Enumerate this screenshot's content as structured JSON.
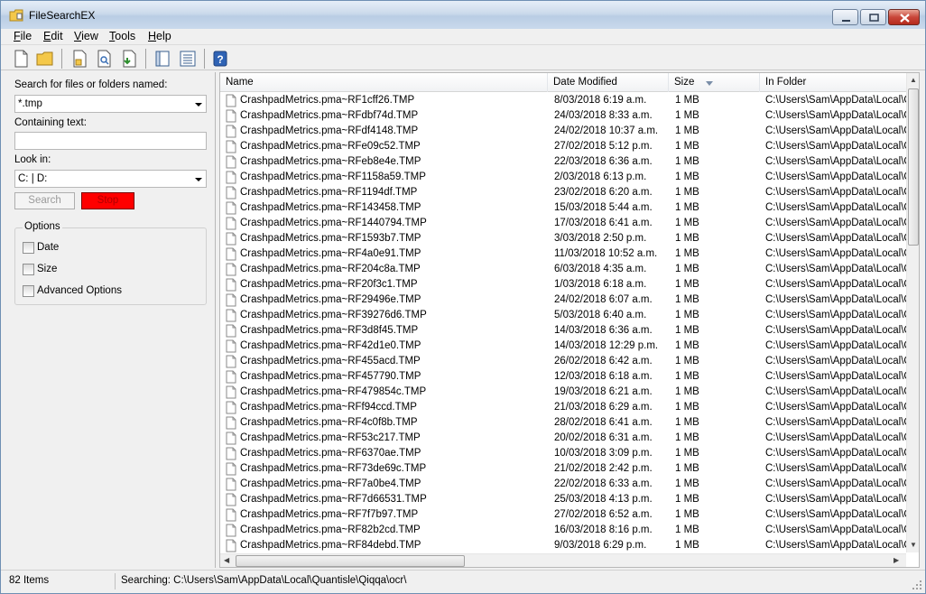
{
  "window": {
    "title": "FileSearchEX"
  },
  "menu": {
    "items": [
      {
        "label": "File"
      },
      {
        "label": "Edit"
      },
      {
        "label": "View"
      },
      {
        "label": "Tools"
      },
      {
        "label": "Help"
      }
    ]
  },
  "toolbar": {
    "icons": [
      "new-icon",
      "open-folder-icon",
      "properties-icon",
      "preview-icon",
      "export-icon",
      "panel-toggle-icon",
      "details-view-icon",
      "help-icon"
    ]
  },
  "search": {
    "name_label": "Search for files or folders named:",
    "name_value": "*.tmp",
    "text_label": "Containing text:",
    "text_value": "",
    "lookin_label": "Look in:",
    "lookin_value": "C: | D:",
    "search_button": "Search",
    "stop_button": "Stop",
    "stop_color": "#ff0000"
  },
  "options": {
    "legend": "Options",
    "items": [
      {
        "label": "Date",
        "checked": false
      },
      {
        "label": "Size",
        "checked": false
      },
      {
        "label": "Advanced Options",
        "checked": false
      }
    ]
  },
  "results": {
    "columns": [
      "Name",
      "Date Modified",
      "Size",
      "In Folder"
    ],
    "rows": [
      {
        "name": "CrashpadMetrics.pma~RF1cff26.TMP",
        "date": "8/03/2018 6:19 a.m.",
        "size": "1 MB",
        "folder": "C:\\Users\\Sam\\AppData\\Local\\G"
      },
      {
        "name": "CrashpadMetrics.pma~RFdbf74d.TMP",
        "date": "24/03/2018 8:33 a.m.",
        "size": "1 MB",
        "folder": "C:\\Users\\Sam\\AppData\\Local\\G"
      },
      {
        "name": "CrashpadMetrics.pma~RFdf4148.TMP",
        "date": "24/02/2018 10:37 a.m.",
        "size": "1 MB",
        "folder": "C:\\Users\\Sam\\AppData\\Local\\G"
      },
      {
        "name": "CrashpadMetrics.pma~RFe09c52.TMP",
        "date": "27/02/2018 5:12 p.m.",
        "size": "1 MB",
        "folder": "C:\\Users\\Sam\\AppData\\Local\\G"
      },
      {
        "name": "CrashpadMetrics.pma~RFeb8e4e.TMP",
        "date": "22/03/2018 6:36 a.m.",
        "size": "1 MB",
        "folder": "C:\\Users\\Sam\\AppData\\Local\\G"
      },
      {
        "name": "CrashpadMetrics.pma~RF1158a59.TMP",
        "date": "2/03/2018 6:13 p.m.",
        "size": "1 MB",
        "folder": "C:\\Users\\Sam\\AppData\\Local\\G"
      },
      {
        "name": "CrashpadMetrics.pma~RF1194df.TMP",
        "date": "23/02/2018 6:20 a.m.",
        "size": "1 MB",
        "folder": "C:\\Users\\Sam\\AppData\\Local\\G"
      },
      {
        "name": "CrashpadMetrics.pma~RF143458.TMP",
        "date": "15/03/2018 5:44 a.m.",
        "size": "1 MB",
        "folder": "C:\\Users\\Sam\\AppData\\Local\\G"
      },
      {
        "name": "CrashpadMetrics.pma~RF1440794.TMP",
        "date": "17/03/2018 6:41 a.m.",
        "size": "1 MB",
        "folder": "C:\\Users\\Sam\\AppData\\Local\\G"
      },
      {
        "name": "CrashpadMetrics.pma~RF1593b7.TMP",
        "date": "3/03/2018 2:50 p.m.",
        "size": "1 MB",
        "folder": "C:\\Users\\Sam\\AppData\\Local\\G"
      },
      {
        "name": "CrashpadMetrics.pma~RF4a0e91.TMP",
        "date": "11/03/2018 10:52 a.m.",
        "size": "1 MB",
        "folder": "C:\\Users\\Sam\\AppData\\Local\\G"
      },
      {
        "name": "CrashpadMetrics.pma~RF204c8a.TMP",
        "date": "6/03/2018 4:35 a.m.",
        "size": "1 MB",
        "folder": "C:\\Users\\Sam\\AppData\\Local\\G"
      },
      {
        "name": "CrashpadMetrics.pma~RF20f3c1.TMP",
        "date": "1/03/2018 6:18 a.m.",
        "size": "1 MB",
        "folder": "C:\\Users\\Sam\\AppData\\Local\\G"
      },
      {
        "name": "CrashpadMetrics.pma~RF29496e.TMP",
        "date": "24/02/2018 6:07 a.m.",
        "size": "1 MB",
        "folder": "C:\\Users\\Sam\\AppData\\Local\\G"
      },
      {
        "name": "CrashpadMetrics.pma~RF39276d6.TMP",
        "date": "5/03/2018 6:40 a.m.",
        "size": "1 MB",
        "folder": "C:\\Users\\Sam\\AppData\\Local\\G"
      },
      {
        "name": "CrashpadMetrics.pma~RF3d8f45.TMP",
        "date": "14/03/2018 6:36 a.m.",
        "size": "1 MB",
        "folder": "C:\\Users\\Sam\\AppData\\Local\\G"
      },
      {
        "name": "CrashpadMetrics.pma~RF42d1e0.TMP",
        "date": "14/03/2018 12:29 p.m.",
        "size": "1 MB",
        "folder": "C:\\Users\\Sam\\AppData\\Local\\G"
      },
      {
        "name": "CrashpadMetrics.pma~RF455acd.TMP",
        "date": "26/02/2018 6:42 a.m.",
        "size": "1 MB",
        "folder": "C:\\Users\\Sam\\AppData\\Local\\G"
      },
      {
        "name": "CrashpadMetrics.pma~RF457790.TMP",
        "date": "12/03/2018 6:18 a.m.",
        "size": "1 MB",
        "folder": "C:\\Users\\Sam\\AppData\\Local\\G"
      },
      {
        "name": "CrashpadMetrics.pma~RF479854c.TMP",
        "date": "19/03/2018 6:21 a.m.",
        "size": "1 MB",
        "folder": "C:\\Users\\Sam\\AppData\\Local\\G"
      },
      {
        "name": "CrashpadMetrics.pma~RFf94ccd.TMP",
        "date": "21/03/2018 6:29 a.m.",
        "size": "1 MB",
        "folder": "C:\\Users\\Sam\\AppData\\Local\\G"
      },
      {
        "name": "CrashpadMetrics.pma~RF4c0f8b.TMP",
        "date": "28/02/2018 6:41 a.m.",
        "size": "1 MB",
        "folder": "C:\\Users\\Sam\\AppData\\Local\\G"
      },
      {
        "name": "CrashpadMetrics.pma~RF53c217.TMP",
        "date": "20/02/2018 6:31 a.m.",
        "size": "1 MB",
        "folder": "C:\\Users\\Sam\\AppData\\Local\\G"
      },
      {
        "name": "CrashpadMetrics.pma~RF6370ae.TMP",
        "date": "10/03/2018 3:09 p.m.",
        "size": "1 MB",
        "folder": "C:\\Users\\Sam\\AppData\\Local\\G"
      },
      {
        "name": "CrashpadMetrics.pma~RF73de69c.TMP",
        "date": "21/02/2018 2:42 p.m.",
        "size": "1 MB",
        "folder": "C:\\Users\\Sam\\AppData\\Local\\G"
      },
      {
        "name": "CrashpadMetrics.pma~RF7a0be4.TMP",
        "date": "22/02/2018 6:33 a.m.",
        "size": "1 MB",
        "folder": "C:\\Users\\Sam\\AppData\\Local\\G"
      },
      {
        "name": "CrashpadMetrics.pma~RF7d66531.TMP",
        "date": "25/03/2018 4:13 p.m.",
        "size": "1 MB",
        "folder": "C:\\Users\\Sam\\AppData\\Local\\G"
      },
      {
        "name": "CrashpadMetrics.pma~RF7f7b97.TMP",
        "date": "27/02/2018 6:52 a.m.",
        "size": "1 MB",
        "folder": "C:\\Users\\Sam\\AppData\\Local\\G"
      },
      {
        "name": "CrashpadMetrics.pma~RF82b2cd.TMP",
        "date": "16/03/2018 8:16 p.m.",
        "size": "1 MB",
        "folder": "C:\\Users\\Sam\\AppData\\Local\\G"
      },
      {
        "name": "CrashpadMetrics.pma~RF84debd.TMP",
        "date": "9/03/2018 6:29 p.m.",
        "size": "1 MB",
        "folder": "C:\\Users\\Sam\\AppData\\Local\\G"
      }
    ]
  },
  "status": {
    "count": "82 Items",
    "searching": "Searching:  C:\\Users\\Sam\\AppData\\Local\\Quantisle\\Qiqqa\\ocr\\"
  }
}
